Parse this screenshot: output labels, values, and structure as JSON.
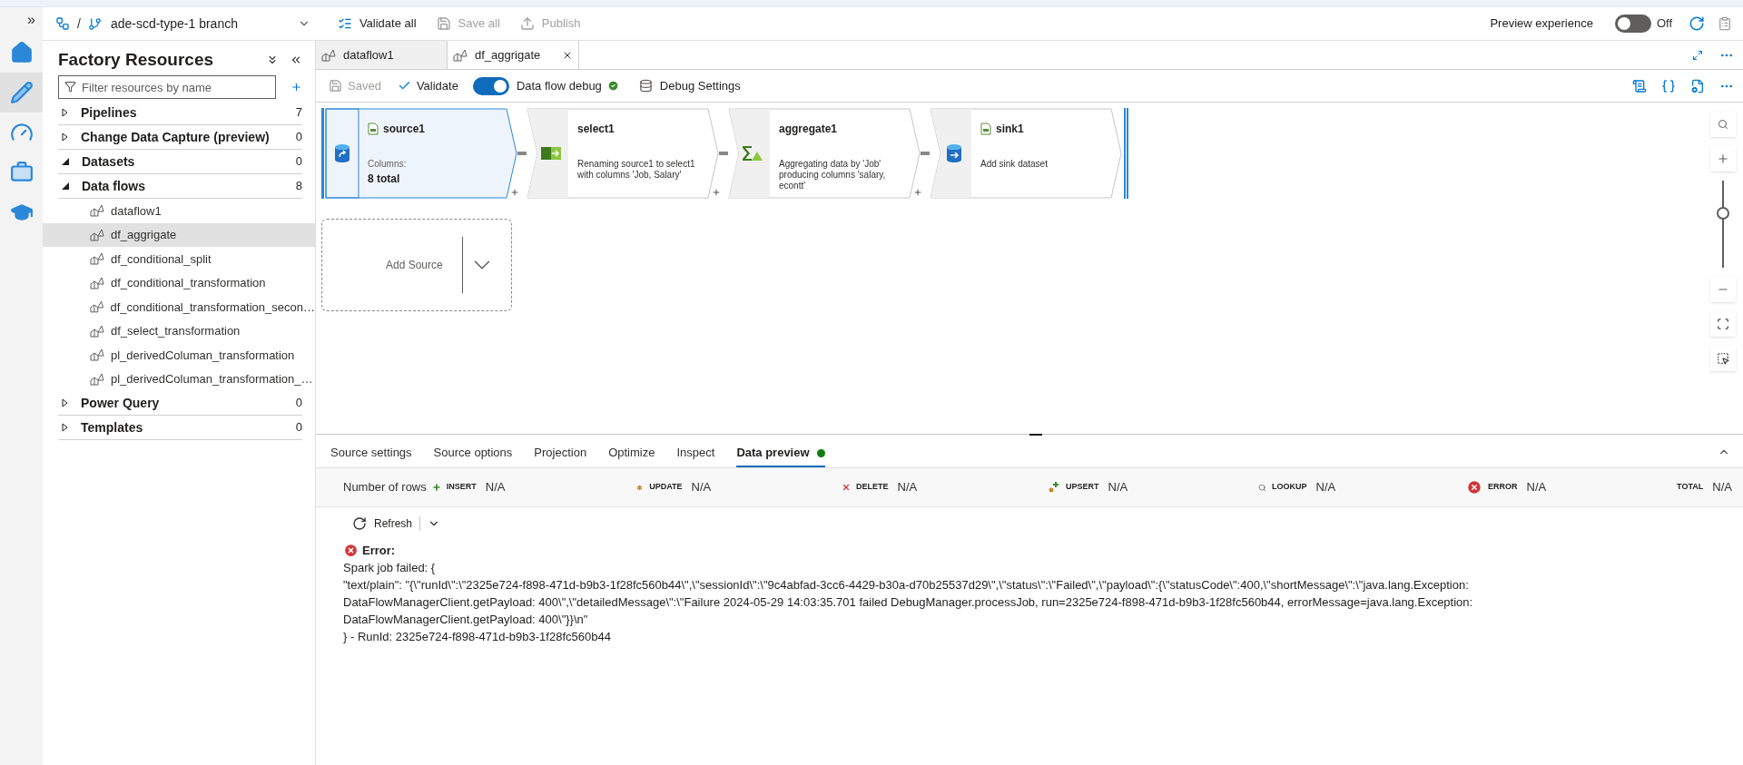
{
  "top_bar": {
    "branch": "ade-scd-type-1 branch",
    "separator": "/",
    "actions": [
      {
        "kind": "validate",
        "label": "Validate all",
        "disabled": false
      },
      {
        "kind": "save",
        "label": "Save all",
        "disabled": true
      },
      {
        "kind": "publish",
        "label": "Publish",
        "disabled": true
      }
    ],
    "preview": {
      "label": "Preview experience",
      "on": false,
      "state_text": "Off"
    }
  },
  "rail": {
    "expand": "»",
    "items": [
      {
        "kind": "home",
        "selected": false
      },
      {
        "kind": "author",
        "selected": true
      },
      {
        "kind": "monitor",
        "selected": false
      },
      {
        "kind": "manage",
        "selected": false
      },
      {
        "kind": "learn",
        "selected": false
      }
    ]
  },
  "sidebar": {
    "title": "Factory Resources",
    "filter": {
      "placeholder": "Filter resources by name"
    },
    "categories": [
      {
        "label": "Pipelines",
        "count": "7",
        "expanded": false
      },
      {
        "label": "Change Data Capture (preview)",
        "count": "0",
        "expanded": false
      },
      {
        "label": "Datasets",
        "count": "0",
        "expanded": true
      },
      {
        "label": "Data flows",
        "count": "8",
        "expanded": true,
        "children": [
          {
            "label": "dataflow1",
            "selected": false
          },
          {
            "label": "df_aggrigate",
            "selected": true
          },
          {
            "label": "df_conditional_split",
            "selected": false
          },
          {
            "label": "df_conditional_transformation",
            "selected": false
          },
          {
            "label": "df_conditional_transformation_secon…",
            "selected": false
          },
          {
            "label": "df_select_transformation",
            "selected": false
          },
          {
            "label": "pl_derivedColuman_transformation",
            "selected": false
          },
          {
            "label": "pl_derivedColuman_transformation_…",
            "selected": false
          }
        ]
      },
      {
        "label": "Power Query",
        "count": "0",
        "expanded": false
      },
      {
        "label": "Templates",
        "count": "0",
        "expanded": false
      }
    ]
  },
  "tabs": [
    {
      "label": "dataflow1",
      "selected": false
    },
    {
      "label": "df_aggrigate",
      "selected": true
    }
  ],
  "toolbar": {
    "saved": {
      "label": "Saved",
      "disabled": true
    },
    "validate": "Validate",
    "debug": {
      "label": "Data flow debug",
      "on": true
    },
    "debug_settings": "Debug Settings"
  },
  "canvas": {
    "nodes": [
      {
        "kind": "source",
        "title": "source1",
        "caption": "Columns:",
        "value": "8 total",
        "selected": true
      },
      {
        "kind": "select",
        "title": "select1",
        "description": "Renaming source1 to select1 with columns 'Job, Salary'",
        "selected": false
      },
      {
        "kind": "aggregate",
        "title": "aggregate1",
        "description": "Aggregating data by 'Job' producing columns 'salary, econtt'",
        "selected": false
      },
      {
        "kind": "sink",
        "title": "sink1",
        "description": "Add sink dataset",
        "selected": false
      }
    ],
    "add_source": "Add Source",
    "zoom": {
      "level": 0.65
    }
  },
  "panel": {
    "tabs": [
      {
        "label": "Source settings",
        "selected": false
      },
      {
        "label": "Source options",
        "selected": false
      },
      {
        "label": "Projection",
        "selected": false
      },
      {
        "label": "Optimize",
        "selected": false
      },
      {
        "label": "Inspect",
        "selected": false
      },
      {
        "label": "Data preview",
        "selected": true
      }
    ],
    "rows_label": "Number of rows",
    "counts": [
      {
        "kind": "insert",
        "label": "INSERT",
        "value": "N/A"
      },
      {
        "kind": "update",
        "label": "UPDATE",
        "value": "N/A"
      },
      {
        "kind": "delete",
        "label": "DELETE",
        "value": "N/A"
      },
      {
        "kind": "upsert",
        "label": "UPSERT",
        "value": "N/A"
      },
      {
        "kind": "lookup",
        "label": "LOOKUP",
        "value": "N/A"
      },
      {
        "kind": "error",
        "label": "ERROR",
        "value": "N/A"
      },
      {
        "kind": "total",
        "label": "TOTAL",
        "value": "N/A"
      }
    ],
    "refresh": "Refresh",
    "error": {
      "title": "Error:",
      "lines": [
        "Spark job failed: {",
        "\"text/plain\": \"{\\\"runId\\\":\\\"2325e724-f898-471d-b9b3-1f28fc560b44\\\",\\\"sessionId\\\":\\\"9c4abfad-3cc6-4429-b30a-d70b25537d29\\\",\\\"status\\\":\\\"Failed\\\",\\\"payload\\\":{\\\"statusCode\\\":400,\\\"shortMessage\\\":\\\"java.lang.Exception:",
        "DataFlowManagerClient.getPayload: 400\\\",\\\"detailedMessage\\\":\\\"Failure 2024-05-29 14:03:35.701 failed DebugManager.processJob, run=2325e724-f898-471d-b9b3-1f28fc560b44, errorMessage=java.lang.Exception:",
        "DataFlowManagerClient.getPayload: 400\\\"}}\\n\"",
        "} - RunId: 2325e724-f898-471d-b9b3-1f28fc560b44"
      ]
    }
  }
}
